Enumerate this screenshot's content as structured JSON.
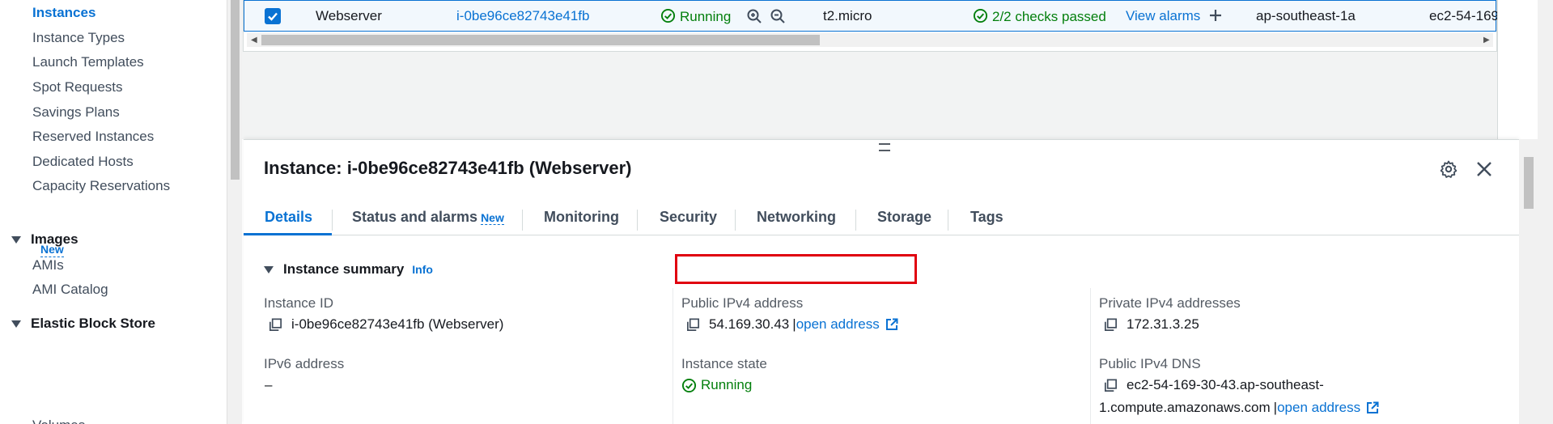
{
  "sidebar": {
    "items": [
      {
        "label": "Instances",
        "active": true
      },
      {
        "label": "Instance Types"
      },
      {
        "label": "Launch Templates"
      },
      {
        "label": "Spot Requests"
      },
      {
        "label": "Savings Plans"
      },
      {
        "label": "Reserved Instances"
      },
      {
        "label": "Dedicated Hosts"
      },
      {
        "label": "Capacity Reservations"
      }
    ],
    "new_badge": "New",
    "sections": [
      {
        "label": "Images",
        "items": [
          "AMIs",
          "AMI Catalog"
        ]
      },
      {
        "label": "Elastic Block Store",
        "items": [
          "Volumes"
        ]
      }
    ]
  },
  "table": {
    "row": {
      "name": "Webserver",
      "instance_id": "i-0be96ce82743e41fb",
      "state": "Running",
      "type": "t2.micro",
      "status_check": "2/2 checks passed",
      "alarms": "View alarms",
      "az": "ap-southeast-1a",
      "dns": "ec2-54-169"
    }
  },
  "panel": {
    "title": "Instance: i-0be96ce82743e41fb (Webserver)",
    "tabs": [
      {
        "label": "Details",
        "active": true
      },
      {
        "label": "Status and alarms",
        "badge": "New"
      },
      {
        "label": "Monitoring"
      },
      {
        "label": "Security"
      },
      {
        "label": "Networking"
      },
      {
        "label": "Storage"
      },
      {
        "label": "Tags"
      }
    ],
    "summary": {
      "heading": "Instance summary",
      "info": "Info",
      "instance_id_label": "Instance ID",
      "instance_id_value": "i-0be96ce82743e41fb (Webserver)",
      "ipv6_label": "IPv6 address",
      "ipv6_value": "–",
      "public_ipv4_label": "Public IPv4 address",
      "public_ipv4_value": "54.169.30.43",
      "separator": "|",
      "open_address": "open address",
      "state_label": "Instance state",
      "state_value": "Running",
      "private_ipv4_label": "Private IPv4 addresses",
      "private_ipv4_value": "172.31.3.25",
      "public_dns_label": "Public IPv4 DNS",
      "public_dns_line1": "ec2-54-169-30-43.ap-southeast-",
      "public_dns_line2": "1.compute.amazonaws.com"
    }
  },
  "colors": {
    "accent": "#0972d3",
    "success": "#037f0c",
    "highlight": "#e0000f"
  },
  "icons": [
    "checkbox-checked-icon",
    "status-ok-icon",
    "zoom-in-icon",
    "zoom-out-icon",
    "plus-icon",
    "gear-icon",
    "close-icon",
    "copy-icon",
    "external-link-icon",
    "caret-down-icon"
  ]
}
